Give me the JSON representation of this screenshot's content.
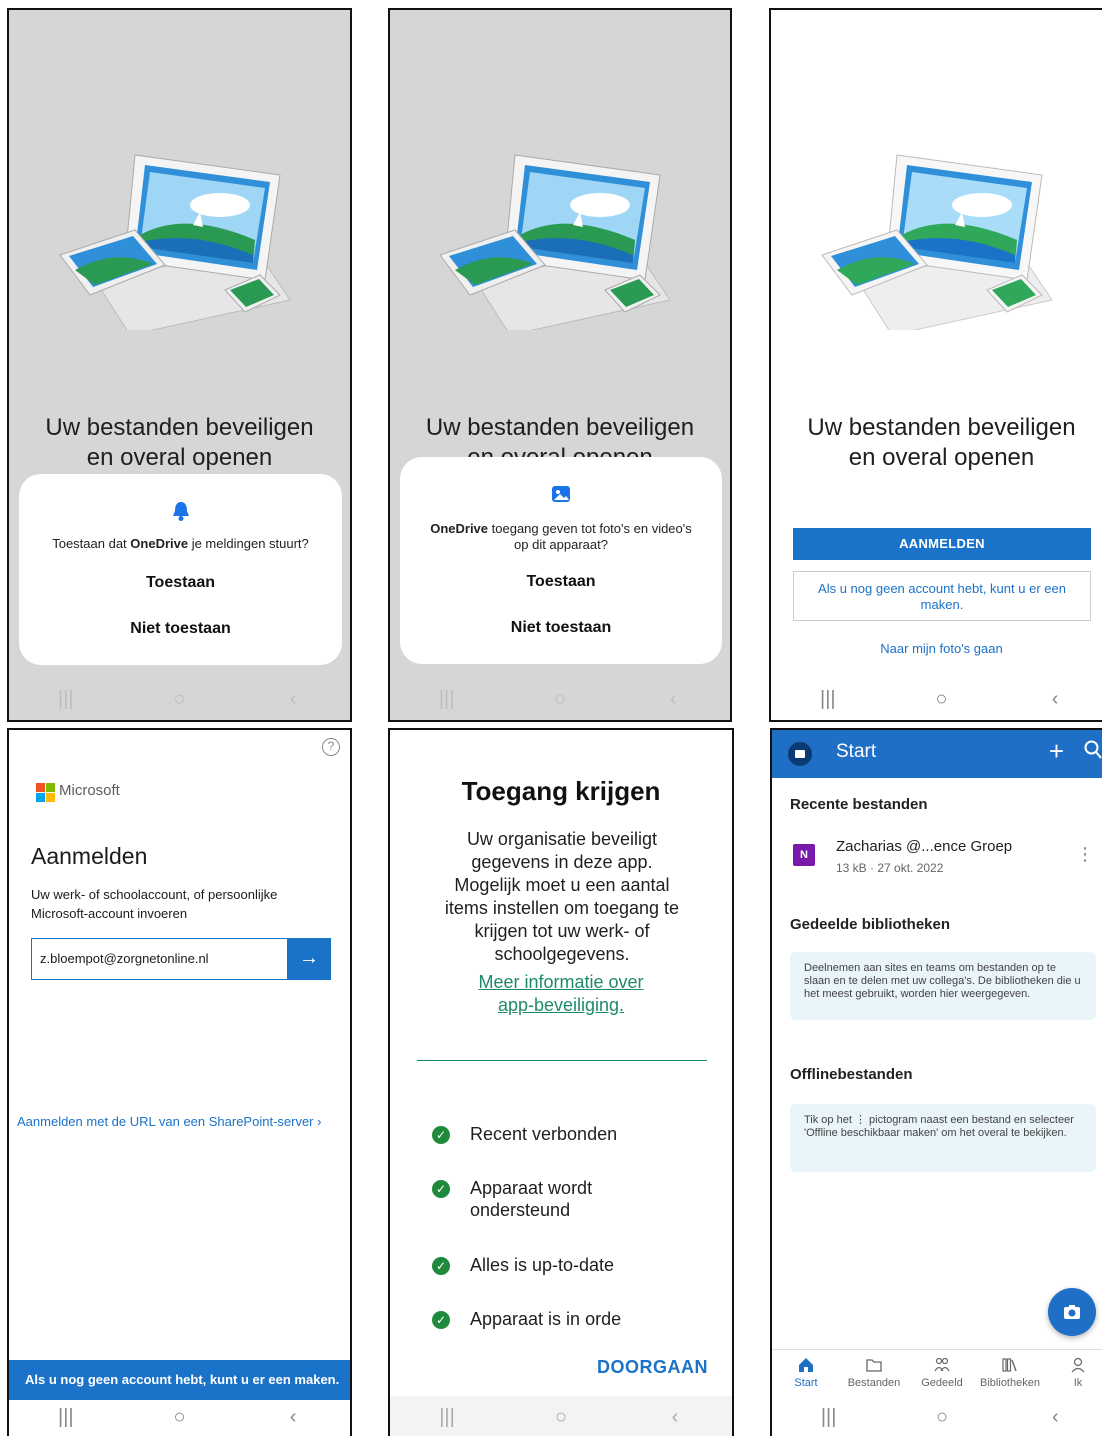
{
  "common": {
    "headline_line1": "Uw bestanden beveiligen",
    "headline_line2": "en overal openen",
    "nav": {
      "recents": "|||",
      "home": "○",
      "back": "‹"
    }
  },
  "screen1": {
    "msg_before": "Toestaan dat ",
    "app": "OneDrive",
    "msg_after": " je meldingen stuurt?",
    "allow": "Toestaan",
    "deny": "Niet toestaan",
    "icon": "bell-icon"
  },
  "screen2": {
    "app": "OneDrive",
    "msg_after": " toegang geven tot foto's en video's op dit apparaat?",
    "allow": "Toestaan",
    "deny": "Niet toestaan",
    "icon": "photo-icon"
  },
  "screen3": {
    "signin": "AANMELDEN",
    "create_account": "Als u nog geen account hebt, kunt u er een maken.",
    "photos": "Naar mijn foto's gaan"
  },
  "screen4": {
    "brand": "Microsoft",
    "title": "Aanmelden",
    "subtitle": "Uw werk- of schoolaccount, of persoonlijke Microsoft-account invoeren",
    "email_value": "z.bloempot@zorgnetonline.nl",
    "sharepoint_link": "Aanmelden met de URL van een SharePoint-server",
    "bottom_banner": "Als u nog geen account hebt, kunt u er een maken.",
    "colors": {
      "red": "#f25022",
      "green": "#7fba00",
      "blue": "#00a4ef",
      "yellow": "#ffb900"
    }
  },
  "screen5": {
    "title": "Toegang krijgen",
    "body": "Uw organisatie beveiligt gegevens in deze app. Mogelijk moet u een aantal items instellen om toegang te krijgen tot uw werk- of schoolgegevens.",
    "more_info_line1": "Meer informatie over",
    "more_info_line2": "app-beveiliging.",
    "checks": [
      "Recent verbonden",
      "Apparaat wordt ondersteund",
      "Alles is up-to-date",
      "Apparaat is in orde"
    ],
    "continue": "DOORGAAN"
  },
  "screen6": {
    "header_title": "Start",
    "recent_title": "Recente bestanden",
    "file_name": "Zacharias @...ence Groep",
    "file_meta": "13 kB · 27 okt. 2022",
    "shared_title": "Gedeelde bibliotheken",
    "shared_info": "Deelnemen aan sites en teams om bestanden op te slaan en te delen met uw collega's. De bibliotheken die u het meest gebruikt, worden hier weergegeven.",
    "offline_title": "Offlinebestanden",
    "offline_info": "Tik op het ⋮ pictogram naast een bestand en selecteer 'Offline beschikbaar maken' om het overal te bekijken.",
    "tabs": [
      "Start",
      "Bestanden",
      "Gedeeld",
      "Bibliotheken",
      "Ik"
    ],
    "accent": "#1f6fc6"
  }
}
